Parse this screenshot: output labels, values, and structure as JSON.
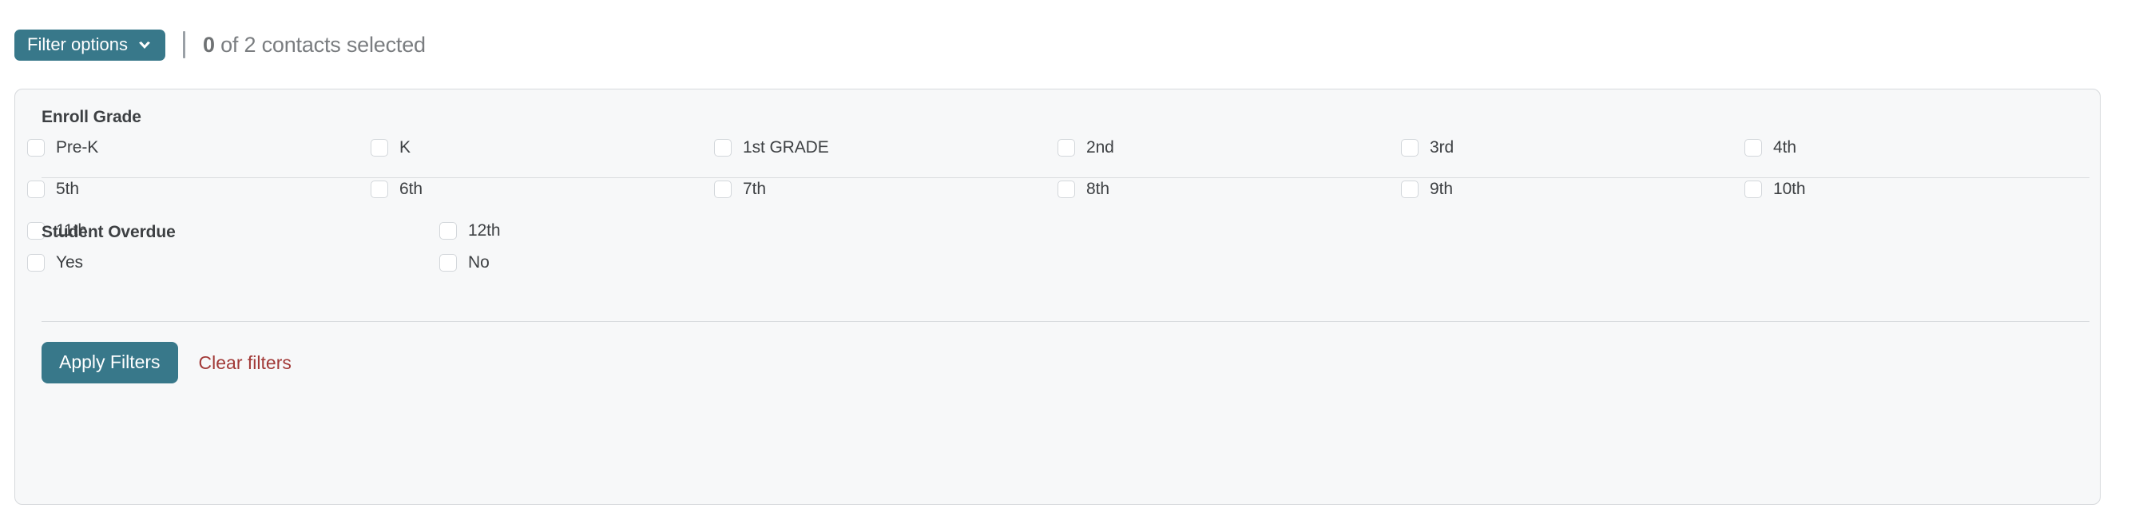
{
  "header": {
    "filter_options_label": "Filter options",
    "chevron_icon": "chevron-down-icon",
    "separator": "|",
    "selection_count": "0",
    "selection_text": " of 2 contacts selected"
  },
  "theme": {
    "accent": "#38788a",
    "danger": "#a23a38",
    "card_bg": "#f7f8f9",
    "card_border": "#d6d9dc",
    "text": "#3d4043",
    "muted_text": "#7a7d80"
  },
  "sections": [
    {
      "title": "Enroll Grade",
      "rows": [
        [
          {
            "label": "Pre-K",
            "checked": false
          },
          {
            "label": "K",
            "checked": false
          },
          {
            "label": "1st GRADE",
            "checked": false
          },
          {
            "label": "2nd",
            "checked": false
          },
          {
            "label": "3rd",
            "checked": false
          },
          {
            "label": "4th",
            "checked": false
          }
        ],
        [
          {
            "label": "5th",
            "checked": false
          },
          {
            "label": "6th",
            "checked": false
          },
          {
            "label": "7th",
            "checked": false
          },
          {
            "label": "8th",
            "checked": false
          },
          {
            "label": "9th",
            "checked": false
          },
          {
            "label": "10th",
            "checked": false
          }
        ],
        [
          {
            "label": "11th",
            "checked": false
          },
          {
            "label": "12th",
            "checked": false
          }
        ]
      ]
    },
    {
      "title": "Student Overdue",
      "rows": [
        [
          {
            "label": "Yes",
            "checked": false
          },
          {
            "label": "No",
            "checked": false
          }
        ]
      ]
    }
  ],
  "actions": {
    "apply_label": "Apply Filters",
    "clear_label": "Clear filters"
  }
}
